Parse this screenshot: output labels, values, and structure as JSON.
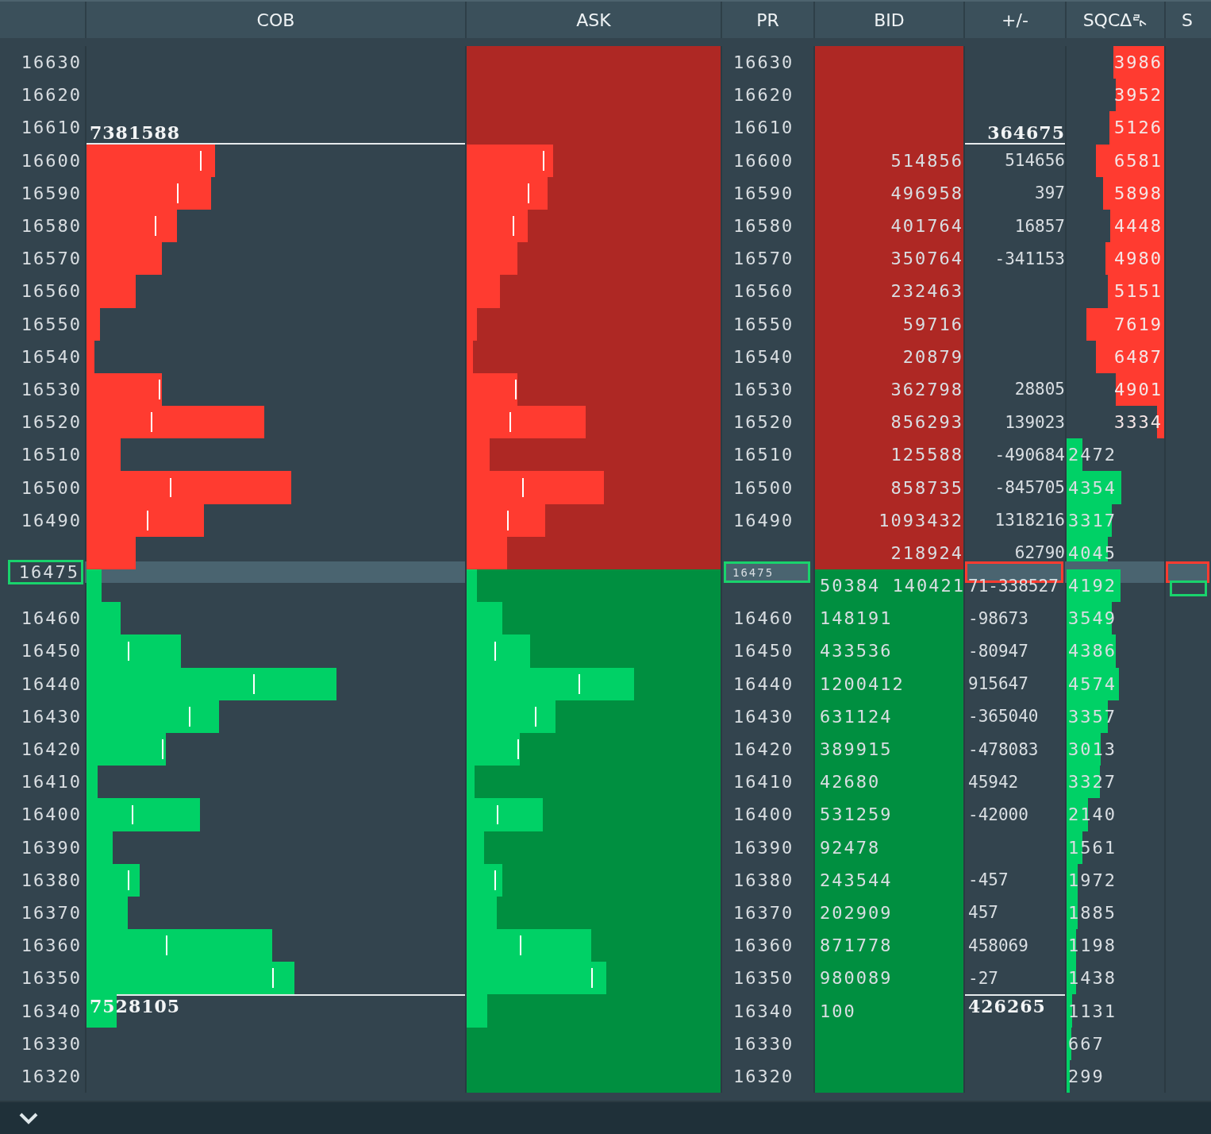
{
  "columns": [
    {
      "label": "COB"
    },
    {
      "label": "ASK"
    },
    {
      "label": "PR"
    },
    {
      "label": "BID"
    },
    {
      "label": "+/-"
    },
    {
      "label": "SQCΔ",
      "icon": true
    },
    {
      "label": "S"
    }
  ],
  "rows": [
    {
      "price": "16630",
      "pr": "16630",
      "kind": "ask",
      "sqc": {
        "text": "3986",
        "level": 0.52
      }
    },
    {
      "price": "16620",
      "pr": "16620",
      "kind": "ask",
      "sqc": {
        "text": "3952",
        "level": 0.5
      }
    },
    {
      "price": "16610",
      "pr": "16610",
      "kind": "ask",
      "cob_total": "7381588",
      "delta_total": "364675",
      "sqc": {
        "text": "5126",
        "level": 0.56
      }
    },
    {
      "price": "16600",
      "pr": "16600",
      "kind": "ask",
      "cob_bar": {
        "level": 0.34
      },
      "ask_bar": {
        "level": 0.34
      },
      "tick": {
        "level": 0.3
      },
      "bid": "514856",
      "delta": "514656",
      "sqc": {
        "text": "6581",
        "level": 0.7
      }
    },
    {
      "price": "16590",
      "pr": "16590",
      "kind": "ask",
      "cob_bar": {
        "level": 0.33
      },
      "ask_bar": {
        "level": 0.32
      },
      "tick": {
        "level": 0.24
      },
      "bid": "496958",
      "delta": "397",
      "sqc": {
        "text": "5898",
        "level": 0.63
      }
    },
    {
      "price": "16580",
      "pr": "16580",
      "kind": "ask",
      "cob_bar": {
        "level": 0.24
      },
      "ask_bar": {
        "level": 0.24
      },
      "tick": {
        "level": 0.18
      },
      "bid": "401764",
      "delta": "16857",
      "sqc": {
        "text": "4448",
        "level": 0.55
      }
    },
    {
      "price": "16570",
      "pr": "16570",
      "kind": "ask",
      "cob_bar": {
        "level": 0.2
      },
      "ask_bar": {
        "level": 0.2
      },
      "bid": "350764",
      "delta": "-341153",
      "sqc": {
        "text": "4980",
        "level": 0.6
      }
    },
    {
      "price": "16560",
      "pr": "16560",
      "kind": "ask",
      "cob_bar": {
        "level": 0.13
      },
      "ask_bar": {
        "level": 0.13
      },
      "bid": "232463",
      "sqc": {
        "text": "5151",
        "level": 0.58
      }
    },
    {
      "price": "16550",
      "pr": "16550",
      "kind": "ask",
      "cob_bar": {
        "level": 0.035
      },
      "ask_bar": {
        "level": 0.04
      },
      "bid": "59716",
      "sqc": {
        "text": "7619",
        "level": 0.8
      }
    },
    {
      "price": "16540",
      "pr": "16540",
      "kind": "ask",
      "cob_bar": {
        "level": 0.02
      },
      "ask_bar": {
        "level": 0.025
      },
      "bid": "20879",
      "sqc": {
        "text": "6487",
        "level": 0.7
      }
    },
    {
      "price": "16530",
      "pr": "16530",
      "kind": "ask",
      "cob_bar": {
        "level": 0.2
      },
      "ask_bar": {
        "level": 0.2
      },
      "tick": {
        "level": 0.19
      },
      "bid": "362798",
      "delta": "28805",
      "sqc": {
        "text": "4901",
        "level": 0.5
      }
    },
    {
      "price": "16520",
      "pr": "16520",
      "kind": "ask",
      "cob_bar": {
        "level": 0.47
      },
      "ask_bar": {
        "level": 0.47
      },
      "tick": {
        "level": 0.17
      },
      "bid": "856293",
      "delta": "139023",
      "sqc": {
        "text": "3334",
        "level": 0.07
      }
    },
    {
      "price": "16510",
      "pr": "16510",
      "kind": "ask",
      "cob_bar": {
        "level": 0.09
      },
      "ask_bar": {
        "level": 0.09
      },
      "bid": "125588",
      "delta": "-490684",
      "sqc": {
        "text": "2472",
        "level": 0.16,
        "kind": "bid"
      }
    },
    {
      "price": "16500",
      "pr": "16500",
      "kind": "ask",
      "cob_bar": {
        "level": 0.54
      },
      "ask_bar": {
        "level": 0.54
      },
      "tick": {
        "level": 0.22
      },
      "bid": "858735",
      "delta": "-845705",
      "sqc": {
        "text": "4354",
        "level": 0.56,
        "kind": "bid"
      }
    },
    {
      "price": "16490",
      "pr": "16490",
      "kind": "ask",
      "cob_bar": {
        "level": 0.31
      },
      "ask_bar": {
        "level": 0.31
      },
      "tick": {
        "level": 0.16
      },
      "bid": "1093432",
      "delta": "1318216",
      "sqc": {
        "text": "3317",
        "level": 0.46,
        "kind": "bid"
      }
    },
    {
      "kind": "ask",
      "cob_bar": {
        "level": 0.13
      },
      "ask_bar": {
        "level": 0.16
      },
      "bid": "218924",
      "delta": "62790",
      "sqc": {
        "text": "4045",
        "level": 0.42,
        "kind": "bid"
      },
      "current": {
        "price": "16475",
        "pr": "16475"
      }
    },
    {
      "kind": "bid",
      "cob_bar": {
        "level": 0.04
      },
      "ask_bar": {
        "level": 0.04
      },
      "bid": "50384 140421",
      "delta": "71-338527",
      "sqc": {
        "text": "4192",
        "level": 0.55,
        "kind": "bid"
      }
    },
    {
      "price": "16460",
      "pr": "16460",
      "kind": "bid",
      "cob_bar": {
        "level": 0.09
      },
      "ask_bar": {
        "level": 0.14
      },
      "bid": "148191",
      "delta": "-98673",
      "sqc": {
        "text": "3549",
        "level": 0.46,
        "kind": "bid"
      }
    },
    {
      "price": "16450",
      "pr": "16450",
      "kind": "bid",
      "cob_bar": {
        "level": 0.25
      },
      "ask_bar": {
        "level": 0.25
      },
      "tick": {
        "level": 0.11
      },
      "bid": "433536",
      "delta": "-80947",
      "sqc": {
        "text": "4386",
        "level": 0.5,
        "kind": "bid"
      }
    },
    {
      "price": "16440",
      "pr": "16440",
      "kind": "bid",
      "cob_bar": {
        "level": 0.66
      },
      "ask_bar": {
        "level": 0.66
      },
      "tick": {
        "level": 0.44
      },
      "bid": "1200412",
      "delta": "915647",
      "sqc": {
        "text": "4574",
        "level": 0.54,
        "kind": "bid"
      }
    },
    {
      "price": "16430",
      "pr": "16430",
      "kind": "bid",
      "cob_bar": {
        "level": 0.35
      },
      "ask_bar": {
        "level": 0.35
      },
      "tick": {
        "level": 0.27
      },
      "bid": "631124",
      "delta": "-365040",
      "sqc": {
        "text": "3357",
        "level": 0.42,
        "kind": "bid"
      }
    },
    {
      "price": "16420",
      "pr": "16420",
      "kind": "bid",
      "cob_bar": {
        "level": 0.21
      },
      "ask_bar": {
        "level": 0.21
      },
      "tick": {
        "level": 0.2
      },
      "bid": "389915",
      "delta": "-478083",
      "sqc": {
        "text": "3013",
        "level": 0.35,
        "kind": "bid"
      }
    },
    {
      "price": "16410",
      "pr": "16410",
      "kind": "bid",
      "cob_bar": {
        "level": 0.03
      },
      "ask_bar": {
        "level": 0.03
      },
      "bid": "42680",
      "delta": "45942",
      "sqc": {
        "text": "3327",
        "level": 0.34,
        "kind": "bid"
      }
    },
    {
      "price": "16400",
      "pr": "16400",
      "kind": "bid",
      "cob_bar": {
        "level": 0.3
      },
      "ask_bar": {
        "level": 0.3
      },
      "tick": {
        "level": 0.12
      },
      "bid": "531259",
      "delta": "-42000",
      "sqc": {
        "text": "2140",
        "level": 0.22,
        "kind": "bid"
      }
    },
    {
      "price": "16390",
      "pr": "16390",
      "kind": "bid",
      "cob_bar": {
        "level": 0.07
      },
      "ask_bar": {
        "level": 0.07
      },
      "bid": "92478",
      "sqc": {
        "text": "1561",
        "level": 0.16,
        "kind": "bid"
      }
    },
    {
      "price": "16380",
      "pr": "16380",
      "kind": "bid",
      "cob_bar": {
        "level": 0.14
      },
      "ask_bar": {
        "level": 0.14
      },
      "tick": {
        "level": 0.11
      },
      "bid": "243544",
      "delta": "-457",
      "sqc": {
        "text": "1972",
        "level": 0.11,
        "kind": "bid"
      }
    },
    {
      "price": "16370",
      "pr": "16370",
      "kind": "bid",
      "cob_bar": {
        "level": 0.11
      },
      "ask_bar": {
        "level": 0.12
      },
      "bid": "202909",
      "delta": "457",
      "sqc": {
        "text": "1885",
        "level": 0.11,
        "kind": "bid"
      }
    },
    {
      "price": "16360",
      "pr": "16360",
      "kind": "bid",
      "cob_bar": {
        "level": 0.49
      },
      "ask_bar": {
        "level": 0.49
      },
      "tick": {
        "level": 0.21
      },
      "bid": "871778",
      "delta": "458069",
      "sqc": {
        "text": "1198",
        "level": 0.1,
        "kind": "bid"
      }
    },
    {
      "price": "16350",
      "pr": "16350",
      "kind": "bid",
      "cob_bar": {
        "level": 0.55
      },
      "ask_bar": {
        "level": 0.55
      },
      "tick": {
        "level": 0.49
      },
      "bid": "980089",
      "delta": "-27",
      "sqc": {
        "text": "1438",
        "level": 0.1,
        "kind": "bid"
      }
    },
    {
      "price": "16340",
      "pr": "16340",
      "kind": "bid",
      "cob_bar": {
        "level": 0.08
      },
      "ask_bar": {
        "level": 0.08
      },
      "bid": "100",
      "cob_total": "7528105",
      "delta_total": "426265",
      "sqc": {
        "text": "1131",
        "level": 0.06,
        "kind": "bid"
      }
    },
    {
      "price": "16330",
      "pr": "16330",
      "kind": "bid",
      "sqc": {
        "text": "667",
        "level": 0.05,
        "kind": "bid"
      }
    },
    {
      "price": "16320",
      "pr": "16320",
      "kind": "bid",
      "sqc": {
        "text": "299",
        "level": 0.03,
        "kind": "bid"
      }
    }
  ]
}
